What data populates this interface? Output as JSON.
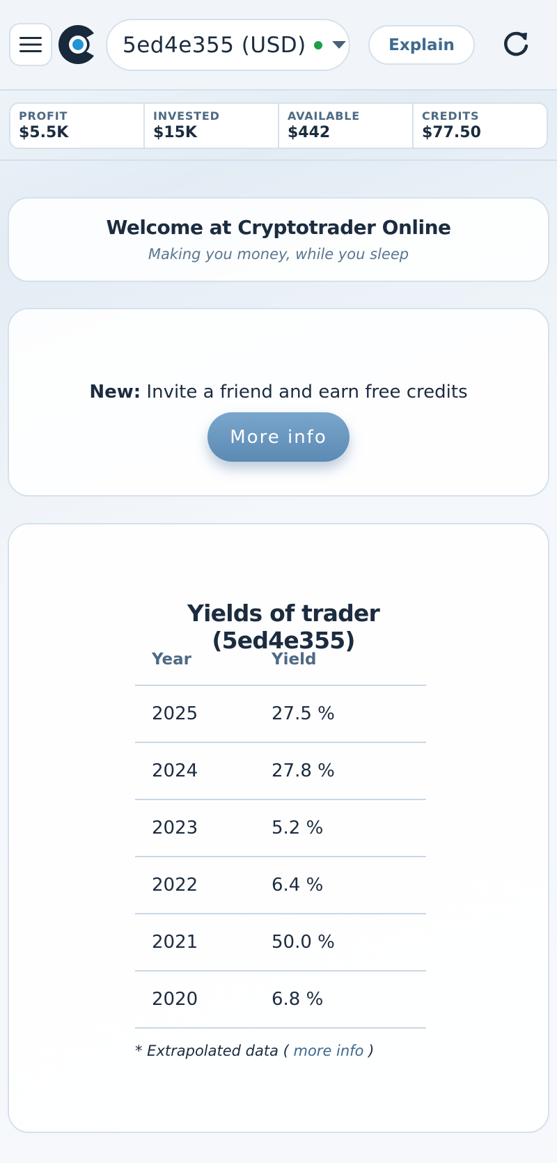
{
  "header": {
    "account_label": "5ed4e355 (USD)",
    "status_color": "#1e9e4a",
    "explain_label": "Explain",
    "icons": [
      "hamburger-menu-icon",
      "app-logo-icon",
      "chevron-down-icon",
      "refresh-icon"
    ]
  },
  "stats": [
    {
      "label": "PROFIT",
      "value": "$5.5K"
    },
    {
      "label": "INVESTED",
      "value": "$15K"
    },
    {
      "label": "AVAILABLE",
      "value": "$442"
    },
    {
      "label": "CREDITS",
      "value": "$77.50"
    }
  ],
  "welcome": {
    "title": "Welcome at Cryptotrader Online",
    "subtitle": "Making you money, while you sleep"
  },
  "invite": {
    "prefix": "New:",
    "text": " Invite a friend and earn free credits",
    "button_label": "More info"
  },
  "yields": {
    "title": "Yields of trader (5ed4e355)",
    "columns": [
      "Year",
      "Yield"
    ],
    "rows": [
      {
        "year": "2025",
        "yield": "27.5 %"
      },
      {
        "year": "2024",
        "yield": "27.8 %"
      },
      {
        "year": "2023",
        "yield": "5.2 %"
      },
      {
        "year": "2022",
        "yield": "6.4 %"
      },
      {
        "year": "2021",
        "yield": "50.0 %"
      },
      {
        "year": "2020",
        "yield": "6.8 %"
      }
    ],
    "footnote_prefix": "* Extrapolated data ( ",
    "footnote_link": "more info",
    "footnote_suffix": " )"
  },
  "colors": {
    "accent": "#3e6a8e",
    "text": "#1c2c3f",
    "border": "#d5e1ec"
  }
}
